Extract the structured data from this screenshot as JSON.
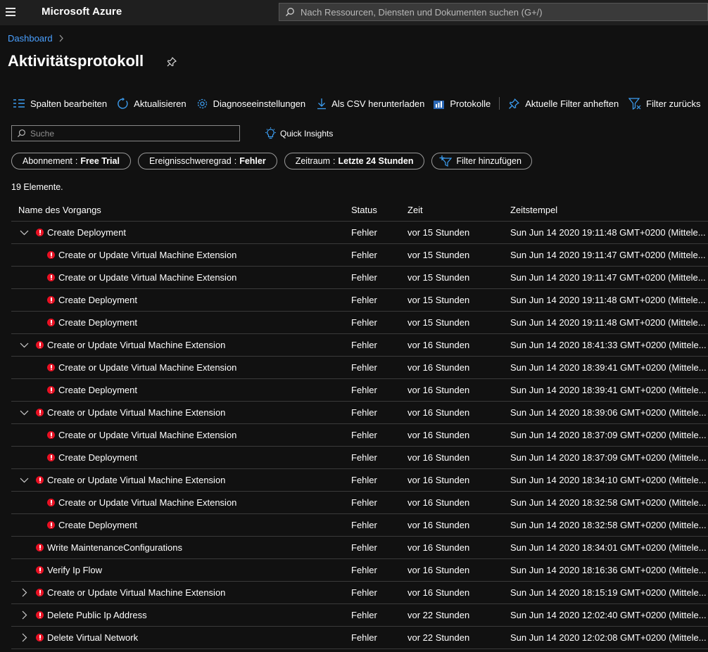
{
  "app": {
    "brand": "Microsoft Azure",
    "search_placeholder": "Nach Ressourcen, Diensten und Dokumenten suchen (G+/)"
  },
  "breadcrumb": {
    "items": [
      "Dashboard"
    ]
  },
  "page": {
    "title": "Aktivitätsprotokoll"
  },
  "toolbar": {
    "edit_columns": "Spalten bearbeiten",
    "refresh": "Aktualisieren",
    "diagnostics": "Diagnoseeinstellungen",
    "download_csv": "Als CSV herunterladen",
    "logs": "Protokolle",
    "pin_filters": "Aktuelle Filter anheften",
    "reset_filters": "Filter zurücks"
  },
  "filter": {
    "search_placeholder": "Suche",
    "quick_insights": "Quick Insights",
    "pills": [
      {
        "key": "Abonnement",
        "value": "Free Trial"
      },
      {
        "key": "Ereignisschweregrad",
        "value": "Fehler"
      },
      {
        "key": "Zeitraum",
        "value": "Letzte 24 Stunden"
      }
    ],
    "add_filter": "Filter hinzufügen"
  },
  "list": {
    "count_label": "19 Elemente.",
    "columns": [
      "Name des Vorgangs",
      "Status",
      "Zeit",
      "Zeitstempel"
    ],
    "rows": [
      {
        "level": 0,
        "expander": "expanded",
        "name": "Create Deployment",
        "status": "Fehler",
        "time": "vor 15 Stunden",
        "timestamp": "Sun Jun 14 2020 19:11:48 GMT+0200 (Mittele..."
      },
      {
        "level": 1,
        "expander": "none",
        "name": "Create or Update Virtual Machine Extension",
        "status": "Fehler",
        "time": "vor 15 Stunden",
        "timestamp": "Sun Jun 14 2020 19:11:47 GMT+0200 (Mittele..."
      },
      {
        "level": 1,
        "expander": "none",
        "name": "Create or Update Virtual Machine Extension",
        "status": "Fehler",
        "time": "vor 15 Stunden",
        "timestamp": "Sun Jun 14 2020 19:11:47 GMT+0200 (Mittele..."
      },
      {
        "level": 1,
        "expander": "none",
        "name": "Create Deployment",
        "status": "Fehler",
        "time": "vor 15 Stunden",
        "timestamp": "Sun Jun 14 2020 19:11:48 GMT+0200 (Mittele..."
      },
      {
        "level": 1,
        "expander": "none",
        "name": "Create Deployment",
        "status": "Fehler",
        "time": "vor 15 Stunden",
        "timestamp": "Sun Jun 14 2020 19:11:48 GMT+0200 (Mittele..."
      },
      {
        "level": 0,
        "expander": "expanded",
        "name": "Create or Update Virtual Machine Extension",
        "status": "Fehler",
        "time": "vor 16 Stunden",
        "timestamp": "Sun Jun 14 2020 18:41:33 GMT+0200 (Mittele..."
      },
      {
        "level": 1,
        "expander": "none",
        "name": "Create or Update Virtual Machine Extension",
        "status": "Fehler",
        "time": "vor 16 Stunden",
        "timestamp": "Sun Jun 14 2020 18:39:41 GMT+0200 (Mittele..."
      },
      {
        "level": 1,
        "expander": "none",
        "name": "Create Deployment",
        "status": "Fehler",
        "time": "vor 16 Stunden",
        "timestamp": "Sun Jun 14 2020 18:39:41 GMT+0200 (Mittele..."
      },
      {
        "level": 0,
        "expander": "expanded",
        "name": "Create or Update Virtual Machine Extension",
        "status": "Fehler",
        "time": "vor 16 Stunden",
        "timestamp": "Sun Jun 14 2020 18:39:06 GMT+0200 (Mittele..."
      },
      {
        "level": 1,
        "expander": "none",
        "name": "Create or Update Virtual Machine Extension",
        "status": "Fehler",
        "time": "vor 16 Stunden",
        "timestamp": "Sun Jun 14 2020 18:37:09 GMT+0200 (Mittele..."
      },
      {
        "level": 1,
        "expander": "none",
        "name": "Create Deployment",
        "status": "Fehler",
        "time": "vor 16 Stunden",
        "timestamp": "Sun Jun 14 2020 18:37:09 GMT+0200 (Mittele..."
      },
      {
        "level": 0,
        "expander": "expanded",
        "name": "Create or Update Virtual Machine Extension",
        "status": "Fehler",
        "time": "vor 16 Stunden",
        "timestamp": "Sun Jun 14 2020 18:34:10 GMT+0200 (Mittele..."
      },
      {
        "level": 1,
        "expander": "none",
        "name": "Create or Update Virtual Machine Extension",
        "status": "Fehler",
        "time": "vor 16 Stunden",
        "timestamp": "Sun Jun 14 2020 18:32:58 GMT+0200 (Mittele..."
      },
      {
        "level": 1,
        "expander": "none",
        "name": "Create Deployment",
        "status": "Fehler",
        "time": "vor 16 Stunden",
        "timestamp": "Sun Jun 14 2020 18:32:58 GMT+0200 (Mittele..."
      },
      {
        "level": 0,
        "expander": "none",
        "name": "Write MaintenanceConfigurations",
        "status": "Fehler",
        "time": "vor 16 Stunden",
        "timestamp": "Sun Jun 14 2020 18:34:01 GMT+0200 (Mittele..."
      },
      {
        "level": 0,
        "expander": "none",
        "name": "Verify Ip Flow",
        "status": "Fehler",
        "time": "vor 16 Stunden",
        "timestamp": "Sun Jun 14 2020 18:16:36 GMT+0200 (Mittele..."
      },
      {
        "level": 0,
        "expander": "collapsed",
        "name": "Create or Update Virtual Machine Extension",
        "status": "Fehler",
        "time": "vor 16 Stunden",
        "timestamp": "Sun Jun 14 2020 18:15:19 GMT+0200 (Mittele..."
      },
      {
        "level": 0,
        "expander": "collapsed",
        "name": "Delete Public Ip Address",
        "status": "Fehler",
        "time": "vor 22 Stunden",
        "timestamp": "Sun Jun 14 2020 12:02:40 GMT+0200 (Mittele..."
      },
      {
        "level": 0,
        "expander": "collapsed",
        "name": "Delete Virtual Network",
        "status": "Fehler",
        "time": "vor 22 Stunden",
        "timestamp": "Sun Jun 14 2020 12:02:08 GMT+0200 (Mittele..."
      }
    ]
  },
  "colors": {
    "error": "#e81123",
    "link": "#4aa0ff",
    "icon_blue": "#3c9df0",
    "background": "#111111"
  }
}
